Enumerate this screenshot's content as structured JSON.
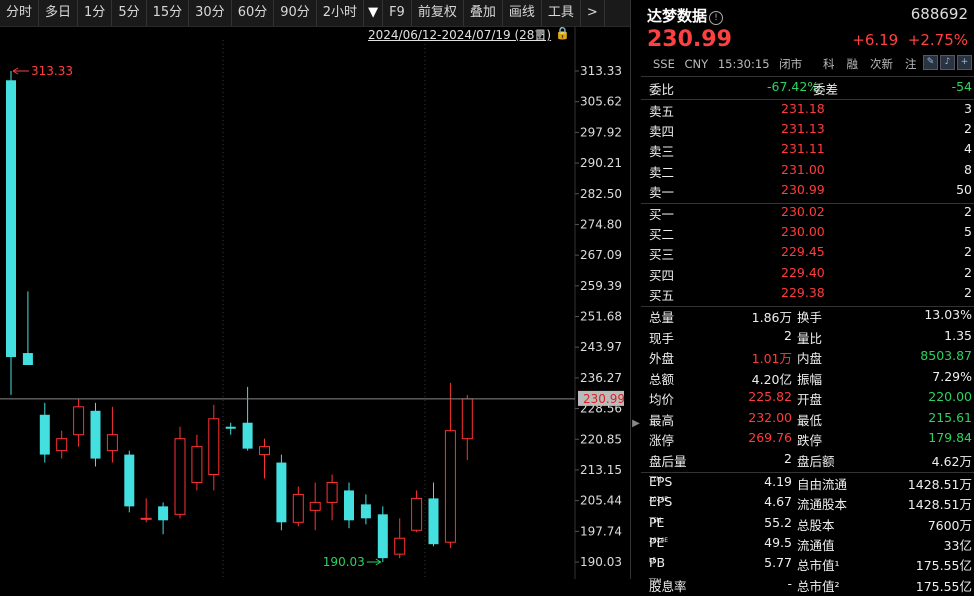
{
  "toolbar": {
    "items": [
      "分时",
      "多日",
      "1分",
      "5分",
      "15分",
      "30分",
      "60分",
      "90分",
      "2小时",
      "▼",
      "F9",
      "前复权",
      "叠加",
      "画线",
      "工具",
      ">"
    ]
  },
  "chart": {
    "range_label": "2024/06/12-2024/07/19 (28日)",
    "high_label": "313.33",
    "low_label": "190.03",
    "current_price_tag": "230.99",
    "y_ticks": [
      "313.33",
      "305.62",
      "297.92",
      "290.21",
      "282.50",
      "274.80",
      "267.09",
      "259.39",
      "251.68",
      "243.97",
      "236.27",
      "228.56",
      "220.85",
      "213.15",
      "205.44",
      "197.74",
      "190.03"
    ],
    "colors": {
      "up": "#ff3232",
      "down": "#44e0e0"
    }
  },
  "chart_data": {
    "type": "candlestick",
    "title": "",
    "date_range": "2024/06/12-2024/07/19",
    "days": 28,
    "ylim": [
      190.03,
      313.33
    ],
    "last_price": 230.99,
    "candles": [
      {
        "o": 311.0,
        "h": 313.33,
        "l": 232.0,
        "c": 241.5
      },
      {
        "o": 242.5,
        "h": 258.0,
        "l": 239.5,
        "c": 239.5
      },
      {
        "o": 227.0,
        "h": 230.0,
        "l": 215.0,
        "c": 217.0
      },
      {
        "o": 218.0,
        "h": 223.0,
        "l": 216.0,
        "c": 221.0
      },
      {
        "o": 222.0,
        "h": 231.0,
        "l": 219.0,
        "c": 229.0
      },
      {
        "o": 228.0,
        "h": 230.0,
        "l": 214.0,
        "c": 216.0
      },
      {
        "o": 218.0,
        "h": 229.0,
        "l": 215.0,
        "c": 222.0
      },
      {
        "o": 217.0,
        "h": 218.0,
        "l": 202.5,
        "c": 204.0
      },
      {
        "o": 201.0,
        "h": 206.0,
        "l": 200.0,
        "c": 201.0
      },
      {
        "o": 204.0,
        "h": 205.0,
        "l": 197.0,
        "c": 200.5
      },
      {
        "o": 202.0,
        "h": 224.0,
        "l": 201.0,
        "c": 221.0
      },
      {
        "o": 210.0,
        "h": 222.0,
        "l": 208.0,
        "c": 219.0
      },
      {
        "o": 212.0,
        "h": 229.5,
        "l": 208.0,
        "c": 226.0
      },
      {
        "o": 224.0,
        "h": 225.0,
        "l": 222.0,
        "c": 223.5
      },
      {
        "o": 225.0,
        "h": 234.0,
        "l": 218.0,
        "c": 218.5
      },
      {
        "o": 217.0,
        "h": 221.0,
        "l": 211.0,
        "c": 219.0
      },
      {
        "o": 215.0,
        "h": 217.0,
        "l": 198.0,
        "c": 200.0
      },
      {
        "o": 200.0,
        "h": 209.0,
        "l": 199.0,
        "c": 207.0
      },
      {
        "o": 203.0,
        "h": 210.0,
        "l": 198.0,
        "c": 205.0
      },
      {
        "o": 205.0,
        "h": 212.0,
        "l": 200.5,
        "c": 210.0
      },
      {
        "o": 208.0,
        "h": 210.0,
        "l": 198.5,
        "c": 200.5
      },
      {
        "o": 204.5,
        "h": 207.0,
        "l": 199.5,
        "c": 201.0
      },
      {
        "o": 202.0,
        "h": 204.0,
        "l": 190.03,
        "c": 191.0
      },
      {
        "o": 192.0,
        "h": 201.0,
        "l": 191.0,
        "c": 196.0
      },
      {
        "o": 198.0,
        "h": 208.0,
        "l": 197.5,
        "c": 206.0
      },
      {
        "o": 206.0,
        "h": 210.0,
        "l": 194.0,
        "c": 194.5
      },
      {
        "o": 195.0,
        "h": 235.0,
        "l": 193.5,
        "c": 223.0
      },
      {
        "o": 221.0,
        "h": 232.0,
        "l": 215.61,
        "c": 230.99
      }
    ]
  },
  "quote": {
    "name": "达梦数据",
    "code": "688692",
    "price": "230.99",
    "change": "+6.19",
    "change_pct": "+2.75%",
    "exchange": "SSE",
    "currency": "CNY",
    "time": "15:30:15",
    "status": "闭市",
    "tags": [
      "科",
      "融",
      "次新",
      "注"
    ]
  },
  "order_book": {
    "weibi_label": "委比",
    "weibi": "-67.42%",
    "weicha_label": "委差",
    "weicha": "-54",
    "asks": [
      {
        "label": "卖五",
        "price": "231.18",
        "vol": "3"
      },
      {
        "label": "卖四",
        "price": "231.13",
        "vol": "2"
      },
      {
        "label": "卖三",
        "price": "231.11",
        "vol": "4"
      },
      {
        "label": "卖二",
        "price": "231.00",
        "vol": "8"
      },
      {
        "label": "卖一",
        "price": "230.99",
        "vol": "50"
      }
    ],
    "bids": [
      {
        "label": "买一",
        "price": "230.02",
        "vol": "2"
      },
      {
        "label": "买二",
        "price": "230.00",
        "vol": "5"
      },
      {
        "label": "买三",
        "price": "229.45",
        "vol": "2"
      },
      {
        "label": "买四",
        "price": "229.40",
        "vol": "2"
      },
      {
        "label": "买五",
        "price": "229.38",
        "vol": "2"
      }
    ]
  },
  "stats": [
    {
      "l1": "总量",
      "v1": "1.86万",
      "c1": "white",
      "l2": "换手",
      "v2": "13.03%",
      "c2": "white"
    },
    {
      "l1": "现手",
      "v1": "2",
      "c1": "white",
      "l2": "量比",
      "v2": "1.35",
      "c2": "white"
    },
    {
      "l1": "外盘",
      "v1": "1.01万",
      "c1": "red",
      "l2": "内盘",
      "v2": "8503.87",
      "c2": "green"
    },
    {
      "l1": "总额",
      "v1": "4.20亿",
      "c1": "white",
      "l2": "振幅",
      "v2": "7.29%",
      "c2": "white"
    },
    {
      "l1": "均价",
      "v1": "225.82",
      "c1": "red",
      "l2": "开盘",
      "v2": "220.00",
      "c2": "green"
    },
    {
      "l1": "最高",
      "v1": "232.00",
      "c1": "red",
      "l2": "最低",
      "v2": "215.61",
      "c2": "green"
    },
    {
      "l1": "涨停",
      "v1": "269.76",
      "c1": "red",
      "l2": "跌停",
      "v2": "179.84",
      "c2": "green"
    },
    {
      "l1": "盘后量",
      "v1": "2",
      "c1": "white",
      "l2": "盘后额",
      "v2": "4.62万",
      "c2": "white"
    }
  ],
  "fundamentals": [
    {
      "l1": "EPS",
      "s1": "TTM",
      "v1": "4.19",
      "l2": "自由流通",
      "v2": "1428.51万"
    },
    {
      "l1": "EPS",
      "s1": "2024E",
      "v1": "4.67",
      "l2": "流通股本",
      "v2": "1428.51万"
    },
    {
      "l1": "PE",
      "s1": "TTM",
      "v1": "55.2",
      "l2": "总股本",
      "v2": "7600万"
    },
    {
      "l1": "PE",
      "s1": "2024E",
      "v1": "49.5",
      "l2": "流通值",
      "v2": "33亿"
    },
    {
      "l1": "PB",
      "s1": "LF",
      "v1": "5.77",
      "l2": "总市值¹",
      "v2": "175.55亿"
    },
    {
      "l1": "股息率",
      "s1": "TTM",
      "v1": "-",
      "l2": "总市值²",
      "v2": "175.55亿"
    }
  ]
}
